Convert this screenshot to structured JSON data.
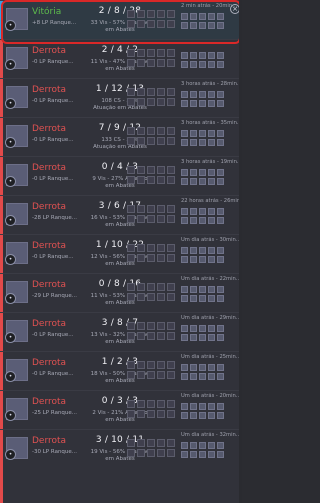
{
  "matches": [
    {
      "result": "Vitória",
      "lp": "+8 LP",
      "queue": "Ranque...",
      "kda": "2 / 8 / 28",
      "stats_line1": "33 Vis - 57% Atuação",
      "stats_line2": "em Abates",
      "time": "2 min atrás - 20min..."
    },
    {
      "result": "Derrota",
      "lp": "-0 LP",
      "queue": "Ranque...",
      "kda": "2 / 4 / 2",
      "stats_line1": "11 Vis - 47% Atuação",
      "stats_line2": "em Abates",
      "time": ""
    },
    {
      "result": "Derrota",
      "lp": "-0 LP",
      "queue": "Ranque...",
      "kda": "1 / 12 / 13",
      "stats_line1": "108 CS - 33%",
      "stats_line2": "Atuação em Abates",
      "time": "3 horas atrás - 28min..."
    },
    {
      "result": "Derrota",
      "lp": "-0 LP",
      "queue": "Ranque...",
      "kda": "7 / 9 / 12",
      "stats_line1": "133 CS - 58%",
      "stats_line2": "Atuação em Abates",
      "time": "3 horas atrás - 35min..."
    },
    {
      "result": "Derrota",
      "lp": "-0 LP",
      "queue": "Ranque...",
      "kda": "0 / 4 / 3",
      "stats_line1": "9 Vis - 27% Atuação",
      "stats_line2": "em Abates",
      "time": "3 horas atrás - 19min..."
    },
    {
      "result": "Derrota",
      "lp": "-28 LP",
      "queue": "Ranque...",
      "kda": "3 / 6 / 17",
      "stats_line1": "16 Vis - 53% Atuação",
      "stats_line2": "em Abates",
      "time": "22 horas atrás - 26min..."
    },
    {
      "result": "Derrota",
      "lp": "-0 LP",
      "queue": "Ranque...",
      "kda": "1 / 10 / 22",
      "stats_line1": "12 Vis - 56% Atuação",
      "stats_line2": "em Abates",
      "time": "Um dia atrás - 30min..."
    },
    {
      "result": "Derrota",
      "lp": "-29 LP",
      "queue": "Ranque...",
      "kda": "0 / 8 / 16",
      "stats_line1": "11 Vis - 53% Atuação",
      "stats_line2": "em Abates",
      "time": "Um dia atrás - 22min..."
    },
    {
      "result": "Derrota",
      "lp": "-0 LP",
      "queue": "Ranque...",
      "kda": "3 / 8 / 7",
      "stats_line1": "13 Vis - 32% Atuação",
      "stats_line2": "em Abates",
      "time": "Um dia atrás - 29min..."
    },
    {
      "result": "Derrota",
      "lp": "-0 LP",
      "queue": "Ranque...",
      "kda": "1 / 2 / 3",
      "stats_line1": "18 Vis - 50% Atuação",
      "stats_line2": "em Abates",
      "time": "Um dia atrás - 25min..."
    },
    {
      "result": "Derrota",
      "lp": "-25 LP",
      "queue": "Ranque...",
      "kda": "0 / 3 / 3",
      "stats_line1": "2 Vis - 21% Atuação",
      "stats_line2": "em Abates",
      "time": "Um dia atrás - 20min..."
    },
    {
      "result": "Derrota",
      "lp": "-30 LP",
      "queue": "Ranque...",
      "kda": "3 / 10 / 11",
      "stats_line1": "19 Vis - 56% Atuação",
      "stats_line2": "em Abates",
      "time": "Um dia atrás - 32min..."
    }
  ]
}
